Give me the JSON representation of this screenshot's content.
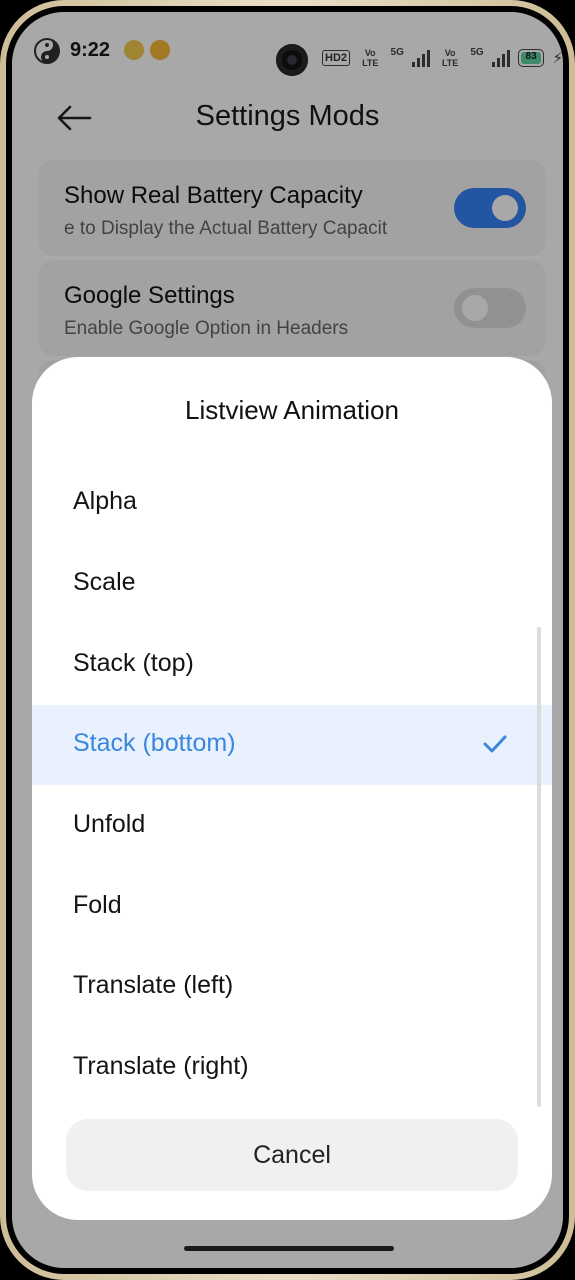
{
  "status_bar": {
    "time": "9:22",
    "hd_label": "HD2",
    "volte1": "Vo LTE",
    "net1": "5G",
    "volte2": "Vo LTE",
    "net2": "5G",
    "battery_level": "83"
  },
  "header": {
    "title": "Settings Mods",
    "back_icon": "arrow-left-icon"
  },
  "settings": [
    {
      "title": "Show Real Battery Capacity",
      "subtitle": "e to Display the Actual Battery Capacit",
      "enabled": true
    },
    {
      "title": "Google Settings",
      "subtitle": "Enable Google Option in Headers",
      "enabled": false
    }
  ],
  "dialog": {
    "title": "Listview Animation",
    "options": [
      {
        "label": "Alpha"
      },
      {
        "label": "Scale"
      },
      {
        "label": "Stack (top)"
      },
      {
        "label": "Stack (bottom)",
        "selected": true
      },
      {
        "label": "Unfold"
      },
      {
        "label": "Fold"
      },
      {
        "label": "Translate (left)"
      },
      {
        "label": "Translate (right)"
      }
    ],
    "cancel_label": "Cancel",
    "check_icon": "checkmark-icon"
  },
  "colors": {
    "accent": "#3c87dd",
    "toggle_on": "#3482f6",
    "selected_row_bg": "#e8f1fd"
  }
}
